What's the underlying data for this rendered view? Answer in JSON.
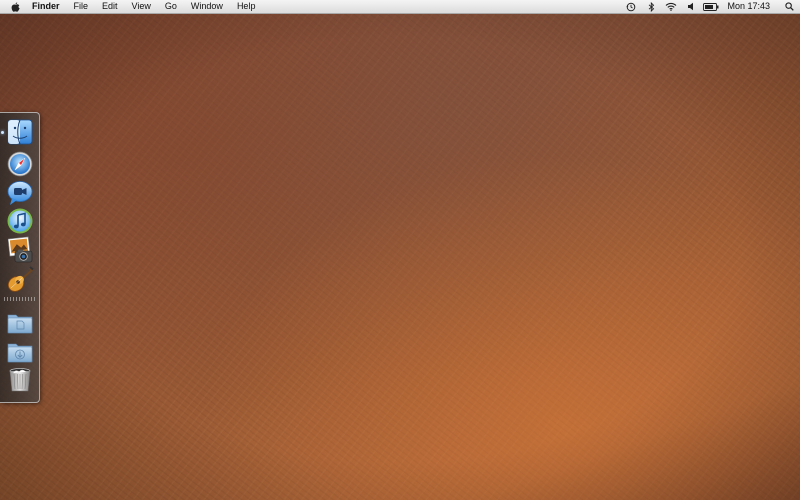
{
  "menubar": {
    "apple_icon": "apple-logo-icon",
    "app_name": "Finder",
    "items": [
      "File",
      "Edit",
      "View",
      "Go",
      "Window",
      "Help"
    ],
    "status_icons": [
      "time-machine-icon",
      "bluetooth-icon",
      "wifi-icon",
      "volume-icon",
      "battery-icon"
    ],
    "clock": "Mon 17:43",
    "spotlight_icon": "spotlight-search-icon"
  },
  "dock": {
    "position": "left",
    "apps": [
      {
        "name": "Finder",
        "icon": "finder-icon",
        "running": true
      },
      {
        "name": "Safari",
        "icon": "safari-compass-icon",
        "running": false
      },
      {
        "name": "iChat",
        "icon": "ichat-video-bubble-icon",
        "running": false
      },
      {
        "name": "iTunes",
        "icon": "itunes-note-icon",
        "running": false
      },
      {
        "name": "iPhoto",
        "icon": "iphoto-camera-icon",
        "running": false
      },
      {
        "name": "GarageBand",
        "icon": "garageband-guitar-icon",
        "running": false
      }
    ],
    "stacks": [
      {
        "name": "Documents",
        "icon": "documents-folder-icon"
      },
      {
        "name": "Downloads",
        "icon": "downloads-folder-icon"
      }
    ],
    "trash": {
      "name": "Trash",
      "icon": "trash-icon"
    }
  },
  "desktop": {
    "wallpaper": "brown-leather-texture"
  }
}
